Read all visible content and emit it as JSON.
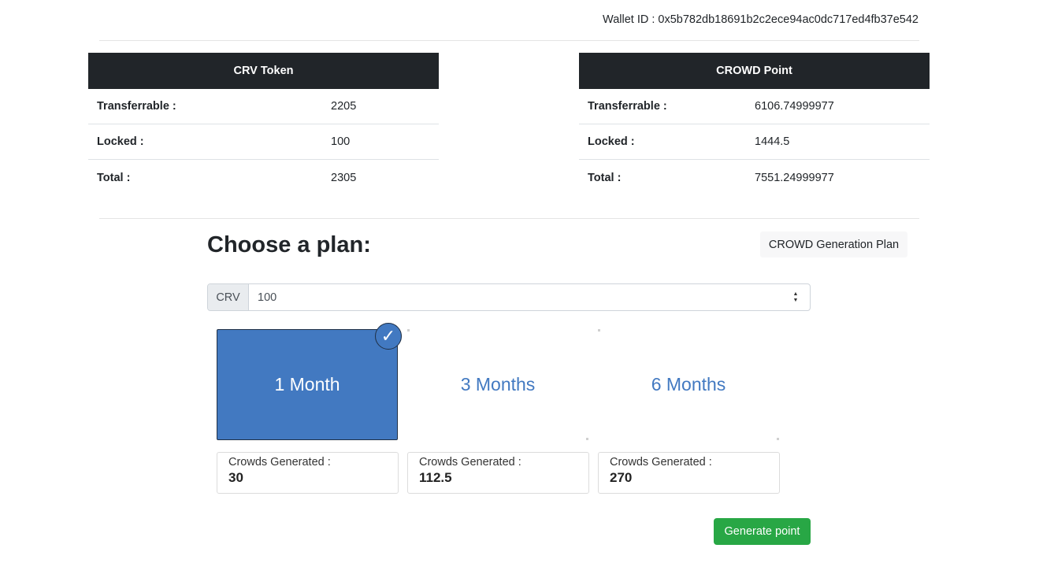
{
  "wallet": {
    "label": "Wallet ID : 0x5b782db18691b2c2ece94ac0dc717ed4fb37e542"
  },
  "crv_table": {
    "title": "CRV Token",
    "rows": [
      {
        "label": "Transferrable :",
        "value": "2205"
      },
      {
        "label": "Locked :",
        "value": "100"
      },
      {
        "label": "Total :",
        "value": "2305"
      }
    ]
  },
  "crowd_table": {
    "title": "CROWD Point",
    "rows": [
      {
        "label": "Transferrable :",
        "value": "6106.74999977"
      },
      {
        "label": "Locked :",
        "value": "1444.5"
      },
      {
        "label": "Total :",
        "value": "7551.24999977"
      }
    ]
  },
  "plan": {
    "title": "Choose a plan:",
    "generation_plan_button": "CROWD Generation Plan",
    "input_prefix": "CRV",
    "input_value": "100",
    "options": [
      {
        "label": "1 Month",
        "selected": true,
        "generated_label": "Crowds Generated :",
        "generated_value": "30"
      },
      {
        "label": "3 Months",
        "selected": false,
        "generated_label": "Crowds Generated :",
        "generated_value": "112.5"
      },
      {
        "label": "6 Months",
        "selected": false,
        "generated_label": "Crowds Generated :",
        "generated_value": "270"
      }
    ],
    "check_icon": "✓",
    "generate_button": "Generate point"
  },
  "colors": {
    "header_dark": "#212529",
    "accent_blue": "#4279c1",
    "success_green": "#28a745"
  }
}
